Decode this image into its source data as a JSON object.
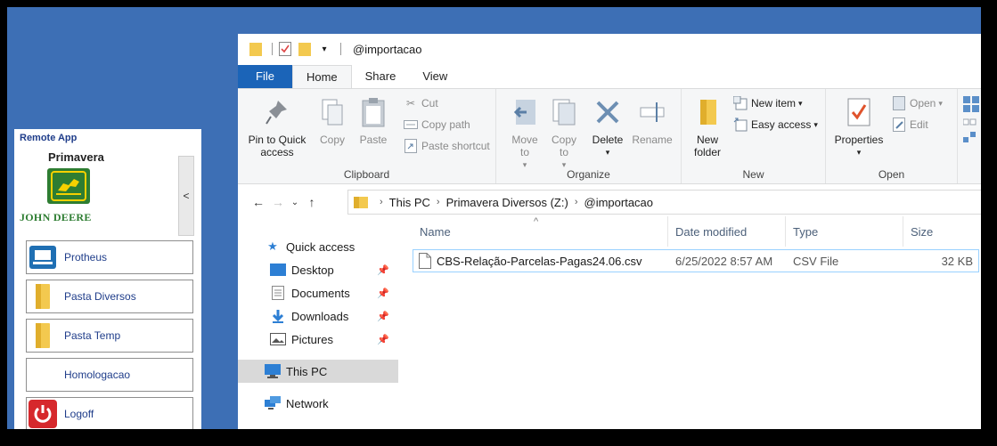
{
  "remote_app": {
    "title": "Remote App",
    "brand_name": "Primavera",
    "brand_caption": "JOHN DEERE",
    "collapse_glyph": "<",
    "buttons": [
      {
        "label": "Protheus",
        "icon": "laptop-icon"
      },
      {
        "label": "Pasta Diversos",
        "icon": "folder-icon"
      },
      {
        "label": "Pasta Temp",
        "icon": "folder-icon"
      },
      {
        "label": "Homologacao",
        "icon": ""
      },
      {
        "label": "Logoff",
        "icon": "power-icon"
      }
    ]
  },
  "explorer": {
    "title": "@importacao",
    "tabs": [
      "File",
      "Home",
      "Share",
      "View"
    ],
    "active_tab": "Home",
    "ribbon": {
      "clipboard": {
        "label": "Clipboard",
        "pin_to_quick_access": "Pin to Quick access",
        "copy": "Copy",
        "paste": "Paste",
        "cut": "Cut",
        "copy_path": "Copy path",
        "paste_shortcut": "Paste shortcut"
      },
      "organize": {
        "label": "Organize",
        "move_to": "Move to",
        "copy_to": "Copy to",
        "delete": "Delete",
        "rename": "Rename"
      },
      "new": {
        "label": "New",
        "new_folder": "New folder",
        "new_item": "New item",
        "easy_access": "Easy access"
      },
      "open": {
        "label": "Open",
        "properties": "Properties",
        "open": "Open",
        "edit": "Edit"
      }
    },
    "address": {
      "crumbs": [
        "This PC",
        "Primavera Diversos (Z:)",
        "@importacao"
      ]
    },
    "nav_pane": {
      "quick_access": "Quick access",
      "desktop": "Desktop",
      "documents": "Documents",
      "downloads": "Downloads",
      "pictures": "Pictures",
      "this_pc": "This PC",
      "network": "Network"
    },
    "columns": {
      "name": "Name",
      "date_modified": "Date modified",
      "type": "Type",
      "size": "Size"
    },
    "files": [
      {
        "name": "CBS-Relação-Parcelas-Pagas24.06.csv",
        "date_modified": "6/25/2022 8:57 AM",
        "type": "CSV File",
        "size": "32 KB"
      }
    ]
  },
  "colors": {
    "desktop": "#3d6fb5",
    "file_tab": "#1b64b8",
    "remote_text": "#1f3d8a",
    "john_deere_green": "#2e7d32",
    "selection_border": "#99d1ff"
  }
}
